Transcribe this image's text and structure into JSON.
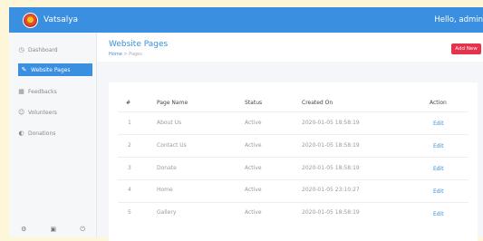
{
  "header": {
    "brand": "Vatsalya",
    "greeting": "Hello, admin"
  },
  "sidebar": {
    "items": [
      {
        "label": "Dashboard",
        "icon": "dashboard-icon"
      },
      {
        "label": "Website Pages",
        "icon": "pages-icon",
        "active": true
      },
      {
        "label": "Feedbacks",
        "icon": "feedback-icon"
      },
      {
        "label": "Volunteers",
        "icon": "volunteers-icon"
      },
      {
        "label": "Donations",
        "icon": "donations-icon"
      }
    ],
    "footer_icons": [
      "settings-icon",
      "screen-icon",
      "power-icon"
    ]
  },
  "page": {
    "title": "Website Pages",
    "breadcrumb_home": "Home",
    "breadcrumb_sep": ">",
    "breadcrumb_current": "Pages",
    "add_button": "Add New"
  },
  "table": {
    "headers": [
      "#",
      "Page Name",
      "Status",
      "Created On",
      "Action"
    ],
    "rows": [
      {
        "num": "1",
        "name": "About Us",
        "status": "Active",
        "created": "2020-01-05 18:58:19",
        "action": "Edit"
      },
      {
        "num": "2",
        "name": "Contact Us",
        "status": "Active",
        "created": "2020-01-05 18:58:19",
        "action": "Edit"
      },
      {
        "num": "3",
        "name": "Donate",
        "status": "Active",
        "created": "2020-01-05 18:58:19",
        "action": "Edit"
      },
      {
        "num": "4",
        "name": "Home",
        "status": "Active",
        "created": "2020-01-05 23:10:27",
        "action": "Edit"
      },
      {
        "num": "5",
        "name": "Gallery",
        "status": "Active",
        "created": "2020-01-05 18:58:19",
        "action": "Edit"
      }
    ]
  }
}
